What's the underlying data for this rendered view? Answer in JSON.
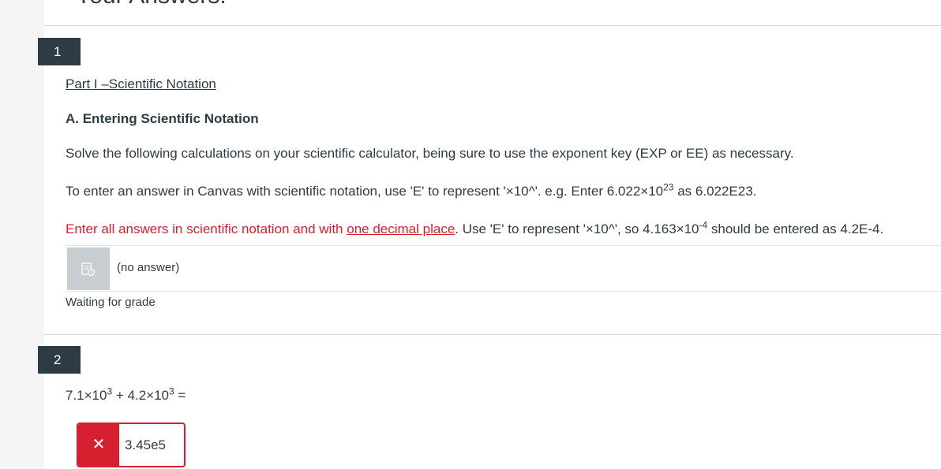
{
  "page_heading": "Your Answers:",
  "questions": [
    {
      "number": "1",
      "part_title": "Part I –Scientific Notation",
      "section_title": "A. Entering Scientific Notation",
      "instruction1": "Solve the following calculations on your scientific calculator, being sure to use the exponent key (EXP or EE) as necessary.",
      "instruction2_a": "To enter an answer in Canvas with scientific notation, use 'E' to represent '×10^'.  e.g. Enter 6.022×10",
      "instruction2_sup": "23",
      "instruction2_b": " as 6.022E23.",
      "instruction3_red_a": "Enter all answers in scientific notation and with ",
      "instruction3_red_link": "one decimal place",
      "instruction3_b": ".  Use 'E' to represent '×10^', so 4.163×10",
      "instruction3_sup": "-4",
      "instruction3_c": " should be entered as 4.2E-4.",
      "answer": "(no answer)",
      "status": "Waiting for grade"
    },
    {
      "number": "2",
      "expr_a": "7.1×10",
      "expr_sup1": "3",
      "expr_b": " + 4.2×10",
      "expr_sup2": "3",
      "expr_c": " =",
      "answer_value": "3.45e5",
      "answer_status_icon": "close-icon",
      "answer_color": "#d6202f"
    }
  ]
}
